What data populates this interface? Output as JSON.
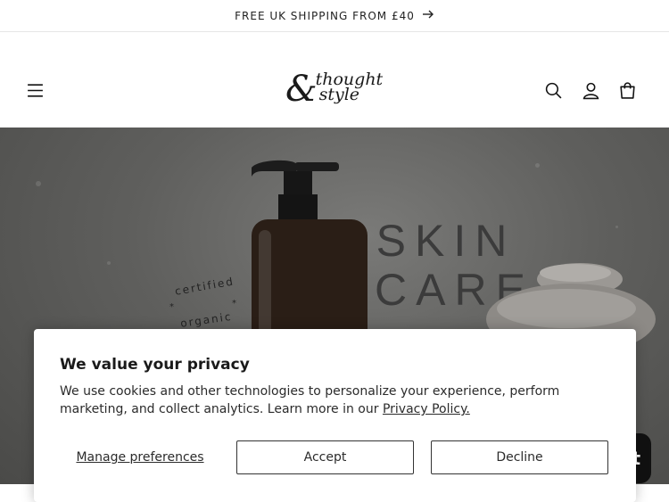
{
  "announcement": {
    "text": "FREE UK SHIPPING FROM £40",
    "arrow_icon": "arrow-right-icon"
  },
  "header": {
    "logo": {
      "ampersand": "&",
      "line1": "thought",
      "line2": "style"
    },
    "icons": {
      "menu": "hamburger-menu-icon",
      "search": "search-icon",
      "account": "user-icon",
      "cart": "shopping-bag-icon"
    }
  },
  "hero": {
    "title_line1": "SKIN",
    "title_line2": "CARE",
    "badge_top": "certified",
    "badge_bottom": "organic"
  },
  "chat": {
    "label": "t"
  },
  "cookie_banner": {
    "title": "We value your privacy",
    "text": "We use cookies and other technologies to personalize your experience, perform marketing, and collect analytics. Learn more in our ",
    "link_text": "Privacy Policy.",
    "manage_label": "Manage preferences",
    "accept_label": "Accept",
    "decline_label": "Decline"
  },
  "colors": {
    "text": "#121212",
    "hero_bg": "#5f5f5d",
    "banner_bg": "#ffffff"
  }
}
